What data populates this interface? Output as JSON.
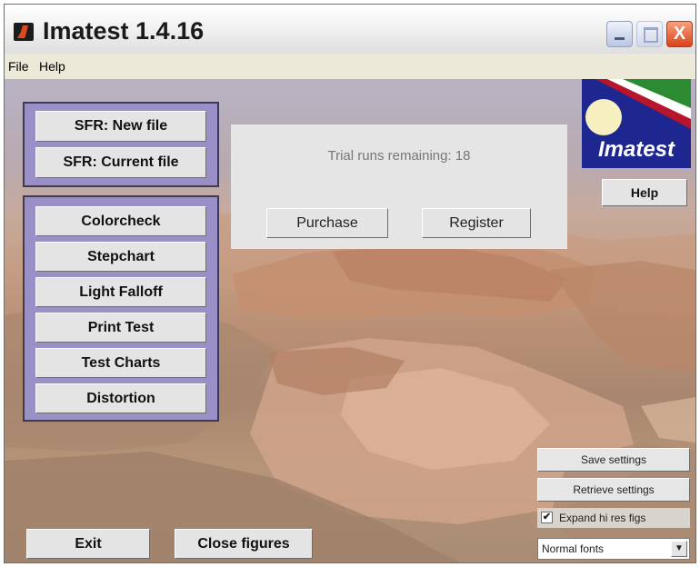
{
  "window": {
    "title": "Imatest 1.4.16",
    "controls": {
      "minimize": "_",
      "maximize": "□",
      "close": "X"
    }
  },
  "menu": {
    "file": "File",
    "help": "Help"
  },
  "sfr_group": {
    "new_file": "SFR: New file",
    "current_file": "SFR: Current file"
  },
  "modules": [
    "Colorcheck",
    "Stepchart",
    "Light Falloff",
    "Print Test",
    "Test Charts",
    "Distortion"
  ],
  "trial_dialog": {
    "message": "Trial runs remaining: 18",
    "purchase": "Purchase",
    "register": "Register"
  },
  "logo": {
    "text": "Imatest"
  },
  "help_button": "Help",
  "settings": {
    "save": "Save settings",
    "retrieve": "Retrieve settings",
    "expand_label": "Expand hi res figs",
    "expand_checked": true,
    "check_mark": "✔",
    "font_select": "Normal fonts",
    "select_arrow": "▼"
  },
  "footer": {
    "exit": "Exit",
    "close_figures": "Close figures"
  },
  "colors": {
    "group_fill": "#9b8fc8",
    "logo_blue": "#1e2690",
    "close_red": "#d9431a"
  }
}
